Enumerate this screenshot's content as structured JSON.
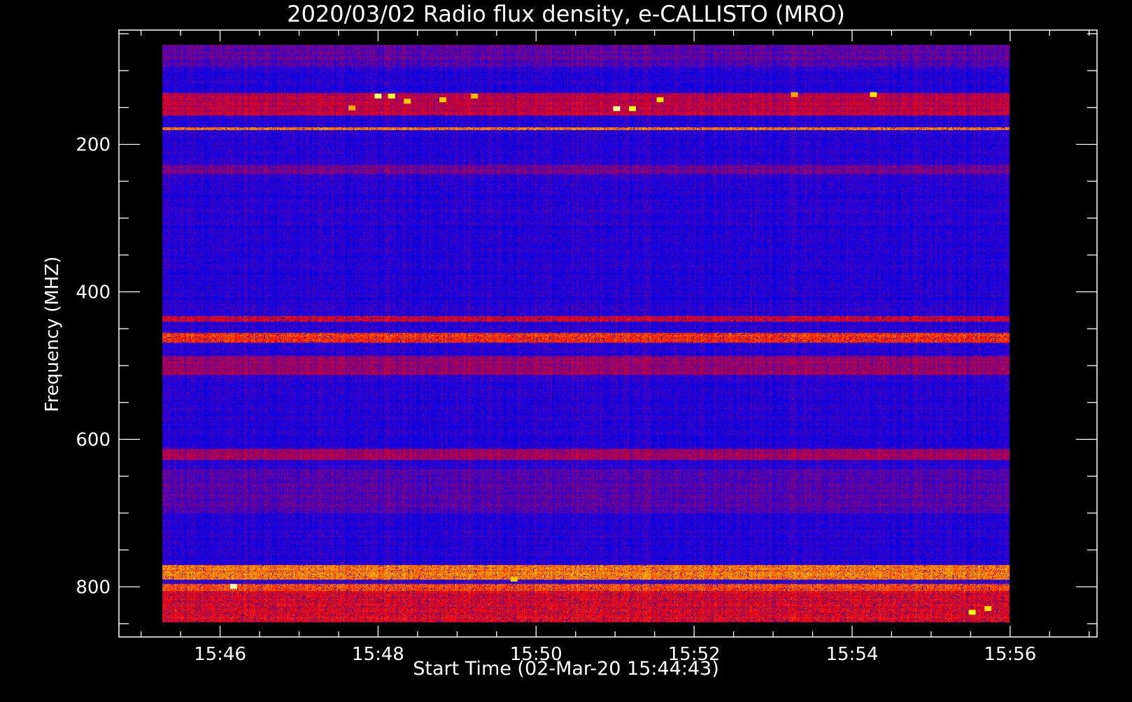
{
  "chart_data": {
    "type": "heatmap",
    "title": "2020/03/02  Radio flux density, e-CALLISTO (MRO)",
    "xlabel": "Start Time (02-Mar-20 15:44:43)",
    "ylabel": "Frequency (MHZ)",
    "x_unit": "minutes after 15:44:43 UT",
    "xlim": [
      0,
      12.38
    ],
    "ylim": [
      868,
      45
    ],
    "x_ticks": [
      {
        "value": 1.28,
        "label": "15:46"
      },
      {
        "value": 3.28,
        "label": "15:48"
      },
      {
        "value": 5.28,
        "label": "15:50"
      },
      {
        "value": 7.28,
        "label": "15:52"
      },
      {
        "value": 9.28,
        "label": "15:54"
      },
      {
        "value": 11.28,
        "label": "15:56"
      }
    ],
    "y_ticks": [
      {
        "value": 200,
        "label": "200"
      },
      {
        "value": 400,
        "label": "400"
      },
      {
        "value": 600,
        "label": "600"
      },
      {
        "value": 800,
        "label": "800"
      }
    ],
    "data_extent": {
      "x": [
        0.55,
        11.27
      ],
      "freq": [
        65,
        848
      ]
    },
    "colormap": [
      "#000000",
      "#0000ff",
      "#ff0000",
      "#ffff00",
      "#ffffff"
    ],
    "background_level": 0.28,
    "bands": [
      {
        "freq": [
          65,
          95
        ],
        "level": 0.34
      },
      {
        "freq": [
          130,
          160
        ],
        "level": 0.43
      },
      {
        "freq": [
          176,
          180
        ],
        "level": 0.62
      },
      {
        "freq": [
          228,
          240
        ],
        "level": 0.36
      },
      {
        "freq": [
          432,
          440
        ],
        "level": 0.46
      },
      {
        "freq": [
          455,
          468
        ],
        "level": 0.55
      },
      {
        "freq": [
          486,
          512
        ],
        "level": 0.4
      },
      {
        "freq": [
          612,
          628
        ],
        "level": 0.4
      },
      {
        "freq": [
          640,
          700
        ],
        "level": 0.33
      },
      {
        "freq": [
          770,
          790
        ],
        "level": 0.62
      },
      {
        "freq": [
          795,
          805
        ],
        "level": 0.58
      },
      {
        "freq": [
          805,
          848
        ],
        "level": 0.48
      }
    ],
    "bursts": [
      {
        "x": 3.28,
        "freq": 135,
        "level": 0.85
      },
      {
        "x": 3.45,
        "freq": 135,
        "level": 0.8
      },
      {
        "x": 3.65,
        "freq": 142,
        "level": 0.7
      },
      {
        "x": 4.1,
        "freq": 140,
        "level": 0.7
      },
      {
        "x": 4.5,
        "freq": 135,
        "level": 0.68
      },
      {
        "x": 6.3,
        "freq": 152,
        "level": 0.9
      },
      {
        "x": 6.5,
        "freq": 152,
        "level": 0.78
      },
      {
        "x": 6.85,
        "freq": 140,
        "level": 0.72
      },
      {
        "x": 2.95,
        "freq": 151,
        "level": 0.66
      },
      {
        "x": 9.55,
        "freq": 133,
        "level": 0.72
      },
      {
        "x": 8.55,
        "freq": 133,
        "level": 0.66
      },
      {
        "x": 10.8,
        "freq": 835,
        "level": 0.75
      },
      {
        "x": 11.0,
        "freq": 830,
        "level": 0.72
      },
      {
        "x": 1.45,
        "freq": 800,
        "level": 0.92
      },
      {
        "x": 5.0,
        "freq": 790,
        "level": 0.7
      }
    ]
  }
}
